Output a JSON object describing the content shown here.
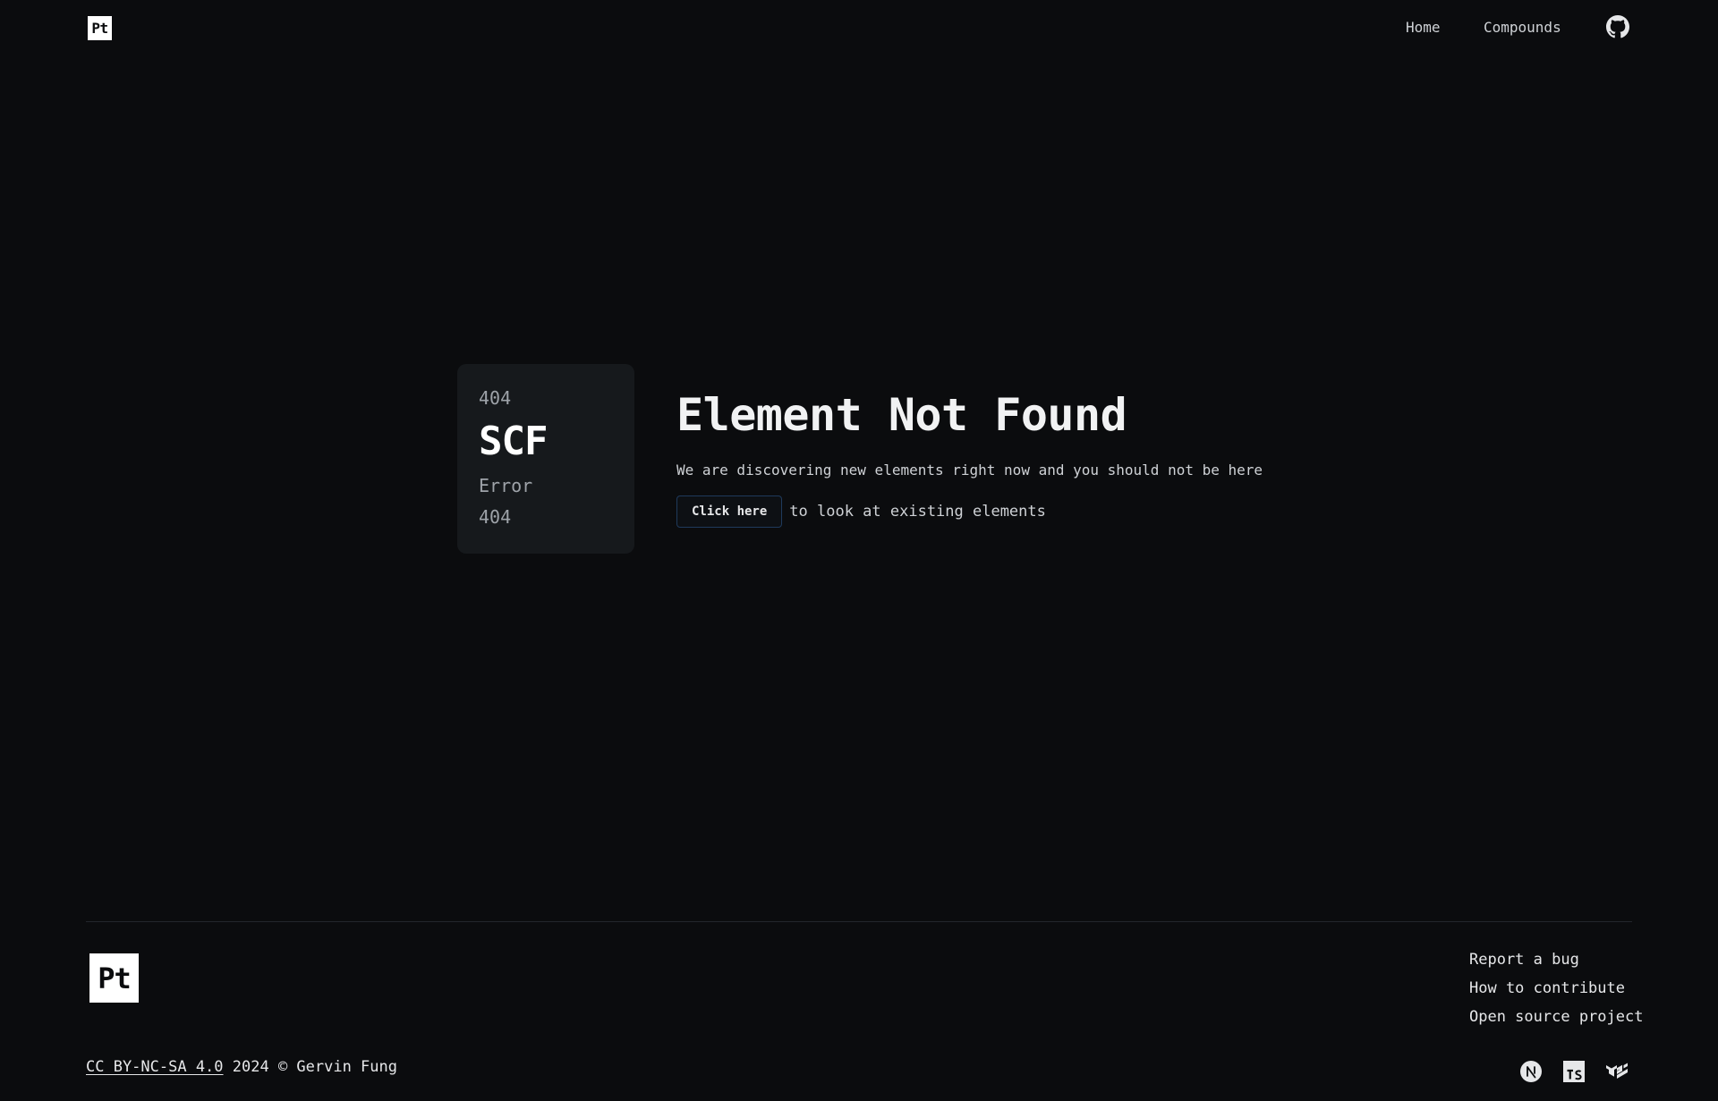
{
  "header": {
    "logo_text": "Pt",
    "nav": {
      "home": "Home",
      "compounds": "Compounds"
    },
    "github_icon": "github-icon"
  },
  "main": {
    "card": {
      "number_top": "404",
      "symbol": "SCF",
      "name": "Error",
      "number_bottom": "404"
    },
    "title": "Element Not Found",
    "subtitle": "We are discovering new elements right now and you should not be here",
    "cta_button": "Click here",
    "cta_suffix": "to look at existing elements"
  },
  "footer": {
    "logo_text": "Pt",
    "links": {
      "report_bug": "Report a bug",
      "contribute": "How to contribute",
      "open_source": "Open source project"
    },
    "license": "CC BY-NC-SA 4.0",
    "copyright_rest": " 2024 © Gervin Fung",
    "tech_icons": [
      "nextjs-icon",
      "typescript-icon",
      "mui-icon"
    ]
  },
  "colors": {
    "background": "#0b0c0e",
    "card": "#16191c",
    "button_border": "#1f3a5c",
    "text": "#e6e7e9"
  }
}
